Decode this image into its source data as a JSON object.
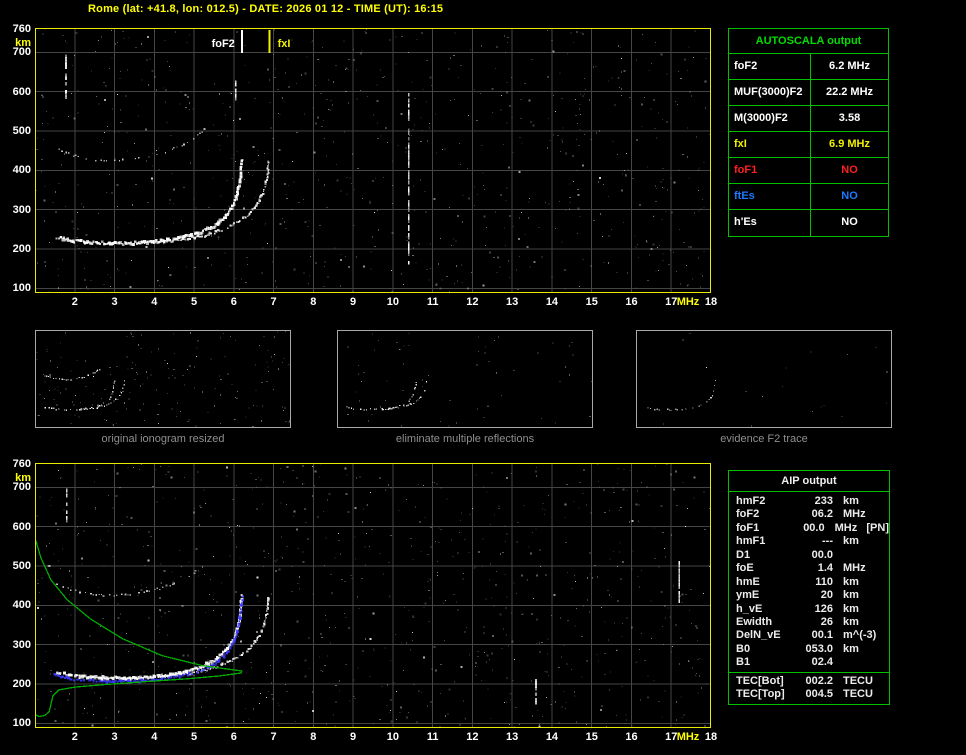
{
  "title": "Rome (lat: +41.8, lon: 012.5) - DATE: 2026 01 12 - TIME (UT): 16:15",
  "autoscala_table": {
    "title": "AUTOSCALA output",
    "rows": [
      {
        "label": "foF2",
        "value": "6.2 MHz",
        "color": "#ffffff"
      },
      {
        "label": "MUF(3000)F2",
        "value": "22.2 MHz",
        "color": "#ffffff"
      },
      {
        "label": "M(3000)F2",
        "value": "3.58",
        "color": "#ffffff"
      },
      {
        "label": "fxI",
        "value": "6.9 MHz",
        "color": "#f2f200"
      },
      {
        "label": "foF1",
        "value": "NO",
        "color": "#ff1f1f"
      },
      {
        "label": "ftEs",
        "value": "NO",
        "color": "#1e78ff"
      },
      {
        "label": "h'Es",
        "value": "NO",
        "color": "#ffffff"
      }
    ]
  },
  "aip_table": {
    "title": "AIP output",
    "rows": [
      {
        "label": "hmF2",
        "value": "233",
        "unit": "km"
      },
      {
        "label": "foF2",
        "value": "06.2",
        "unit": "MHz"
      },
      {
        "label": "foF1",
        "value": "00.0",
        "unit": "MHz   [PN]"
      },
      {
        "label": "hmF1",
        "value": "---",
        "unit": "km"
      },
      {
        "label": "D1",
        "value": "00.0",
        "unit": ""
      },
      {
        "label": "foE",
        "value": "1.4",
        "unit": "MHz"
      },
      {
        "label": "hmE",
        "value": "110",
        "unit": "km"
      },
      {
        "label": "ymE",
        "value": "20",
        "unit": "km"
      },
      {
        "label": "h_vE",
        "value": "126",
        "unit": "km"
      },
      {
        "label": "Ewidth",
        "value": "26",
        "unit": "km"
      },
      {
        "label": "DelN_vE",
        "value": "00.1",
        "unit": "m^(-3)"
      },
      {
        "label": "B0",
        "value": "053.0",
        "unit": "km"
      },
      {
        "label": "B1",
        "value": "02.4",
        "unit": ""
      },
      {
        "label": "TEC[Bot]",
        "value": "002.2",
        "unit": "TECU",
        "sep": true
      },
      {
        "label": "TEC[Top]",
        "value": "004.5",
        "unit": "TECU"
      }
    ]
  },
  "thumbnails": [
    {
      "caption": "original ionogram resized",
      "series": [
        0,
        1,
        2
      ],
      "noise": 170,
      "skip": 0.25,
      "opacity": 1.0
    },
    {
      "caption": "eliminate multiple reflections",
      "series": [
        0,
        1
      ],
      "noise": 60,
      "skip": 0.3,
      "opacity": 0.95
    },
    {
      "caption": "evidence F2 trace",
      "series": [
        0
      ],
      "noise": 18,
      "skip": 0.5,
      "opacity": 0.75
    }
  ],
  "chart_data": [
    {
      "id": "ionogram-top",
      "type": "scatter",
      "title": "scaled ionogram with autoscala markers",
      "xlabel": "MHz",
      "ylabel": "km",
      "xlim": [
        1,
        18
      ],
      "ylim": [
        88,
        762
      ],
      "x_ticks": [
        2,
        3,
        4,
        5,
        6,
        7,
        8,
        9,
        10,
        11,
        12,
        13,
        14,
        15,
        16,
        17,
        18
      ],
      "y_ticks": [
        100,
        200,
        300,
        400,
        500,
        600,
        700,
        760
      ],
      "grid": true,
      "foF2_marker_MHz": 6.2,
      "fxI_marker_MHz": 6.9,
      "annotations": [
        {
          "label": "foF2",
          "x": 6.2,
          "color": "#ffffff",
          "side": "left"
        },
        {
          "label": "fxI",
          "x": 6.9,
          "color": "#f2f200",
          "side": "right"
        }
      ],
      "series": [
        {
          "name": "F2 trace (O-mode)",
          "color": "#ffffff",
          "size": 2.4,
          "step": 1.2,
          "jitter": 2.8,
          "skip": 0.04,
          "points": [
            [
              1.55,
              230
            ],
            [
              2.0,
              220
            ],
            [
              2.6,
              215
            ],
            [
              3.4,
              214
            ],
            [
              4.1,
              219
            ],
            [
              4.7,
              228
            ],
            [
              5.1,
              240
            ],
            [
              5.5,
              257
            ],
            [
              5.8,
              283
            ],
            [
              6.0,
              313
            ],
            [
              6.1,
              345
            ],
            [
              6.17,
              385
            ],
            [
              6.21,
              430
            ]
          ]
        },
        {
          "name": "F2 trace (X-mode)",
          "color": "#f0f0f0",
          "size": 1.9,
          "step": 1.6,
          "jitter": 2.2,
          "skip": 0.15,
          "points": [
            [
              3.6,
              215
            ],
            [
              4.3,
              219
            ],
            [
              4.9,
              227
            ],
            [
              5.4,
              238
            ],
            [
              5.8,
              252
            ],
            [
              6.1,
              268
            ],
            [
              6.4,
              290
            ],
            [
              6.6,
              315
            ],
            [
              6.75,
              345
            ],
            [
              6.84,
              385
            ],
            [
              6.88,
              425
            ]
          ]
        },
        {
          "name": "second hop echo",
          "color": "#d0d0d0",
          "size": 1.5,
          "step": 2.6,
          "jitter": 2.0,
          "skip": 0.38,
          "points": [
            [
              1.55,
              455
            ],
            [
              1.9,
              440
            ],
            [
              2.4,
              428
            ],
            [
              3.0,
              424
            ],
            [
              3.6,
              430
            ],
            [
              4.2,
              444
            ],
            [
              4.7,
              463
            ],
            [
              5.0,
              482
            ],
            [
              5.3,
              508
            ]
          ]
        }
      ],
      "streaks": [
        {
          "x": 1.78,
          "h1": 590,
          "h2": 712
        },
        {
          "x": 10.4,
          "h1": 170,
          "h2": 600
        },
        {
          "x": 6.05,
          "h1": 580,
          "h2": 640
        }
      ],
      "noise": {
        "seed": 20260112,
        "dots": 800
      }
    },
    {
      "id": "ionogram-bottom",
      "type": "scatter",
      "title": "ionogram with AIP inverted profile",
      "xlabel": "MHz",
      "ylabel": "km",
      "xlim": [
        1,
        18
      ],
      "ylim": [
        88,
        762
      ],
      "x_ticks": [
        2,
        3,
        4,
        5,
        6,
        7,
        8,
        9,
        10,
        11,
        12,
        13,
        14,
        15,
        16,
        17,
        18
      ],
      "y_ticks": [
        100,
        200,
        300,
        400,
        500,
        600,
        700,
        760
      ],
      "grid": true,
      "series": [
        {
          "name": "F2 trace (O-mode)",
          "color": "#ffffff",
          "size": 2.4,
          "step": 1.2,
          "jitter": 2.8,
          "skip": 0.04,
          "points": [
            [
              1.55,
              230
            ],
            [
              2.0,
              220
            ],
            [
              2.6,
              215
            ],
            [
              3.4,
              214
            ],
            [
              4.1,
              219
            ],
            [
              4.7,
              228
            ],
            [
              5.1,
              240
            ],
            [
              5.5,
              257
            ],
            [
              5.8,
              283
            ],
            [
              6.0,
              313
            ],
            [
              6.1,
              345
            ],
            [
              6.17,
              385
            ],
            [
              6.21,
              430
            ]
          ]
        },
        {
          "name": "F2 trace (X-mode)",
          "color": "#f0f0f0",
          "size": 1.9,
          "step": 1.6,
          "jitter": 2.2,
          "skip": 0.15,
          "points": [
            [
              3.6,
              215
            ],
            [
              4.3,
              219
            ],
            [
              4.9,
              227
            ],
            [
              5.4,
              238
            ],
            [
              5.8,
              252
            ],
            [
              6.1,
              268
            ],
            [
              6.4,
              290
            ],
            [
              6.6,
              315
            ],
            [
              6.75,
              345
            ],
            [
              6.84,
              385
            ],
            [
              6.88,
              425
            ]
          ]
        },
        {
          "name": "second hop echo",
          "color": "#d0d0d0",
          "size": 1.5,
          "step": 2.6,
          "jitter": 2.0,
          "skip": 0.38,
          "points": [
            [
              1.55,
              455
            ],
            [
              1.9,
              440
            ],
            [
              2.4,
              428
            ],
            [
              3.0,
              424
            ],
            [
              3.6,
              430
            ],
            [
              4.2,
              444
            ],
            [
              4.7,
              463
            ],
            [
              5.0,
              482
            ],
            [
              5.3,
              508
            ]
          ]
        }
      ],
      "restored_trace": {
        "name": "restored F2 trace",
        "color": "#3a3aff",
        "size": 2.2,
        "step": 1.4,
        "jitter": 2.4,
        "skip": 0.1,
        "points": [
          [
            1.5,
            222
          ],
          [
            2.0,
            212
          ],
          [
            2.6,
            207
          ],
          [
            3.4,
            206
          ],
          [
            4.1,
            211
          ],
          [
            4.7,
            220
          ],
          [
            5.1,
            232
          ],
          [
            5.5,
            249
          ],
          [
            5.8,
            275
          ],
          [
            6.0,
            305
          ],
          [
            6.1,
            338
          ],
          [
            6.18,
            378
          ],
          [
            6.23,
            424
          ]
        ]
      },
      "profile": {
        "name": "AIP electron density profile",
        "color": "#00b400",
        "points": [
          [
            1.02,
            565
          ],
          [
            1.15,
            520
          ],
          [
            1.4,
            465
          ],
          [
            1.8,
            415
          ],
          [
            2.4,
            365
          ],
          [
            3.2,
            315
          ],
          [
            4.2,
            272
          ],
          [
            5.2,
            247
          ],
          [
            5.9,
            237
          ],
          [
            6.2,
            233
          ],
          [
            6.18,
            228
          ],
          [
            5.6,
            220
          ],
          [
            4.8,
            213
          ],
          [
            3.8,
            206
          ],
          [
            2.8,
            199
          ],
          [
            2.0,
            192
          ],
          [
            1.6,
            185
          ],
          [
            1.45,
            170
          ],
          [
            1.4,
            148
          ],
          [
            1.36,
            130
          ],
          [
            1.25,
            120
          ],
          [
            1.1,
            117
          ],
          [
            1.02,
            121
          ]
        ]
      },
      "streaks": [
        {
          "x": 1.8,
          "h1": 620,
          "h2": 700
        },
        {
          "x": 17.2,
          "h1": 408,
          "h2": 515
        },
        {
          "x": 13.6,
          "h1": 150,
          "h2": 215
        }
      ],
      "noise": {
        "seed": 771144,
        "dots": 850
      }
    }
  ]
}
